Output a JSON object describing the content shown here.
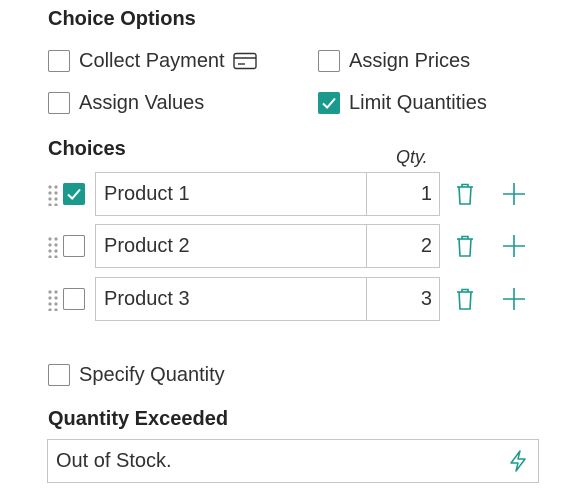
{
  "choice_options": {
    "title": "Choice Options",
    "collect_payment": {
      "label": "Collect Payment",
      "checked": false
    },
    "assign_prices": {
      "label": "Assign Prices",
      "checked": false
    },
    "assign_values": {
      "label": "Assign Values",
      "checked": false
    },
    "limit_quantities": {
      "label": "Limit Quantities",
      "checked": true
    }
  },
  "choices": {
    "title": "Choices",
    "qty_header": "Qty.",
    "rows": [
      {
        "name": "Product 1",
        "qty": "1",
        "checked": true
      },
      {
        "name": "Product 2",
        "qty": "2",
        "checked": false
      },
      {
        "name": "Product 3",
        "qty": "3",
        "checked": false
      }
    ]
  },
  "specify_quantity": {
    "label": "Specify Quantity",
    "checked": false
  },
  "quantity_exceeded": {
    "title": "Quantity Exceeded",
    "message": "Out of Stock."
  },
  "colors": {
    "accent": "#1a9a8c",
    "border": "#c8c6c4",
    "text": "#323130"
  },
  "icons": {
    "payment": "credit-card-icon",
    "drag": "drag-grip-icon",
    "delete": "trash-icon",
    "add": "plus-icon",
    "formula": "lightning-bolt-icon"
  }
}
